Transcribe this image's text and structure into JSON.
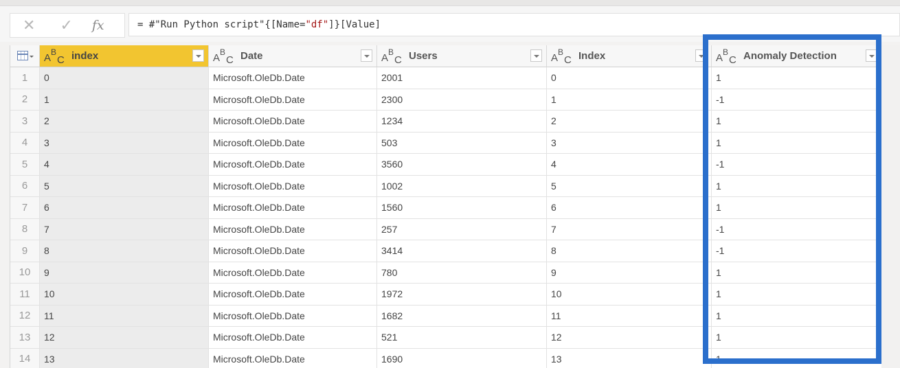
{
  "formula_bar": {
    "cancel_icon": "close-icon",
    "commit_icon": "check-icon",
    "fx_label": "fx",
    "formula_prefix": "= #\"Run Python script\"{[Name=",
    "formula_string": "\"df\"",
    "formula_suffix": "]}[Value]"
  },
  "table": {
    "columns": [
      {
        "label": "index",
        "type_icon": "ABC",
        "selected": true
      },
      {
        "label": "Date",
        "type_icon": "ABC",
        "selected": false
      },
      {
        "label": "Users",
        "type_icon": "ABC",
        "selected": false
      },
      {
        "label": "Index",
        "type_icon": "ABC",
        "selected": false
      },
      {
        "label": "Anomaly Detection",
        "type_icon": "ABC",
        "selected": false
      }
    ],
    "rows": [
      {
        "n": "1",
        "index": "0",
        "date": "Microsoft.OleDb.Date",
        "users": "2001",
        "idx": "0",
        "anomaly": "1"
      },
      {
        "n": "2",
        "index": "1",
        "date": "Microsoft.OleDb.Date",
        "users": "2300",
        "idx": "1",
        "anomaly": "-1"
      },
      {
        "n": "3",
        "index": "2",
        "date": "Microsoft.OleDb.Date",
        "users": "1234",
        "idx": "2",
        "anomaly": "1"
      },
      {
        "n": "4",
        "index": "3",
        "date": "Microsoft.OleDb.Date",
        "users": "503",
        "idx": "3",
        "anomaly": "1"
      },
      {
        "n": "5",
        "index": "4",
        "date": "Microsoft.OleDb.Date",
        "users": "3560",
        "idx": "4",
        "anomaly": "-1"
      },
      {
        "n": "6",
        "index": "5",
        "date": "Microsoft.OleDb.Date",
        "users": "1002",
        "idx": "5",
        "anomaly": "1"
      },
      {
        "n": "7",
        "index": "6",
        "date": "Microsoft.OleDb.Date",
        "users": "1560",
        "idx": "6",
        "anomaly": "1"
      },
      {
        "n": "8",
        "index": "7",
        "date": "Microsoft.OleDb.Date",
        "users": "257",
        "idx": "7",
        "anomaly": "-1"
      },
      {
        "n": "9",
        "index": "8",
        "date": "Microsoft.OleDb.Date",
        "users": "3414",
        "idx": "8",
        "anomaly": "-1"
      },
      {
        "n": "10",
        "index": "9",
        "date": "Microsoft.OleDb.Date",
        "users": "780",
        "idx": "9",
        "anomaly": "1"
      },
      {
        "n": "11",
        "index": "10",
        "date": "Microsoft.OleDb.Date",
        "users": "1972",
        "idx": "10",
        "anomaly": "1"
      },
      {
        "n": "12",
        "index": "11",
        "date": "Microsoft.OleDb.Date",
        "users": "1682",
        "idx": "11",
        "anomaly": "1"
      },
      {
        "n": "13",
        "index": "12",
        "date": "Microsoft.OleDb.Date",
        "users": "521",
        "idx": "12",
        "anomaly": "1"
      },
      {
        "n": "14",
        "index": "13",
        "date": "Microsoft.OleDb.Date",
        "users": "1690",
        "idx": "13",
        "anomaly": "1"
      }
    ]
  },
  "highlight": {
    "color": "#2b6fcc",
    "target": "Anomaly Detection"
  },
  "colors": {
    "selected_header": "#f2c530"
  }
}
